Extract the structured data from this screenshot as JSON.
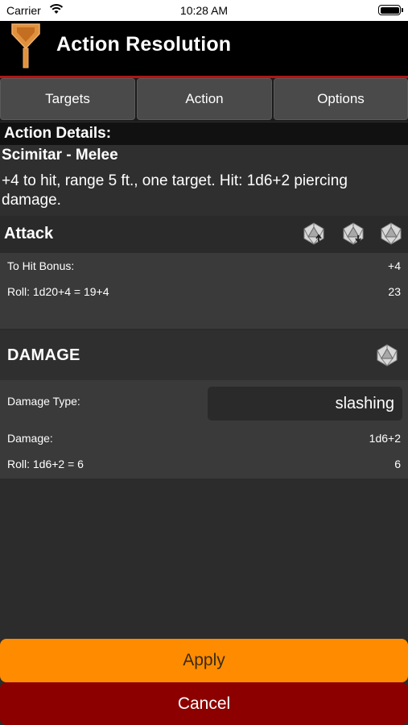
{
  "status_bar": {
    "carrier": "Carrier",
    "time": "10:28 AM"
  },
  "header": {
    "title": "Action Resolution"
  },
  "tabs": [
    {
      "label": "Targets"
    },
    {
      "label": "Action"
    },
    {
      "label": "Options"
    }
  ],
  "details": {
    "caption": "Action Details:",
    "action_name": "Scimitar - Melee",
    "description": "+4 to hit, range 5 ft., one target. Hit: 1d6+2 piercing damage."
  },
  "attack": {
    "label": "Attack",
    "dice_icons": [
      "d20-advantage-icon",
      "d20-disadvantage-icon",
      "d20-icon"
    ],
    "to_hit_label": "To Hit Bonus:",
    "to_hit_value": "+4",
    "roll_label": "Roll: 1d20+4 = 19+4",
    "roll_value": "23"
  },
  "damage": {
    "label": "DAMAGE",
    "type_label": "Damage Type:",
    "type_value": "slashing",
    "damage_label": "Damage:",
    "damage_value": "1d6+2",
    "roll_label": "Roll: 1d6+2 = 6",
    "roll_value": "6"
  },
  "buttons": {
    "apply": "Apply",
    "cancel": "Cancel"
  },
  "colors": {
    "accent_orange": "#ff8c00",
    "cancel_red": "#8c0000",
    "header_rule": "#b01515"
  }
}
